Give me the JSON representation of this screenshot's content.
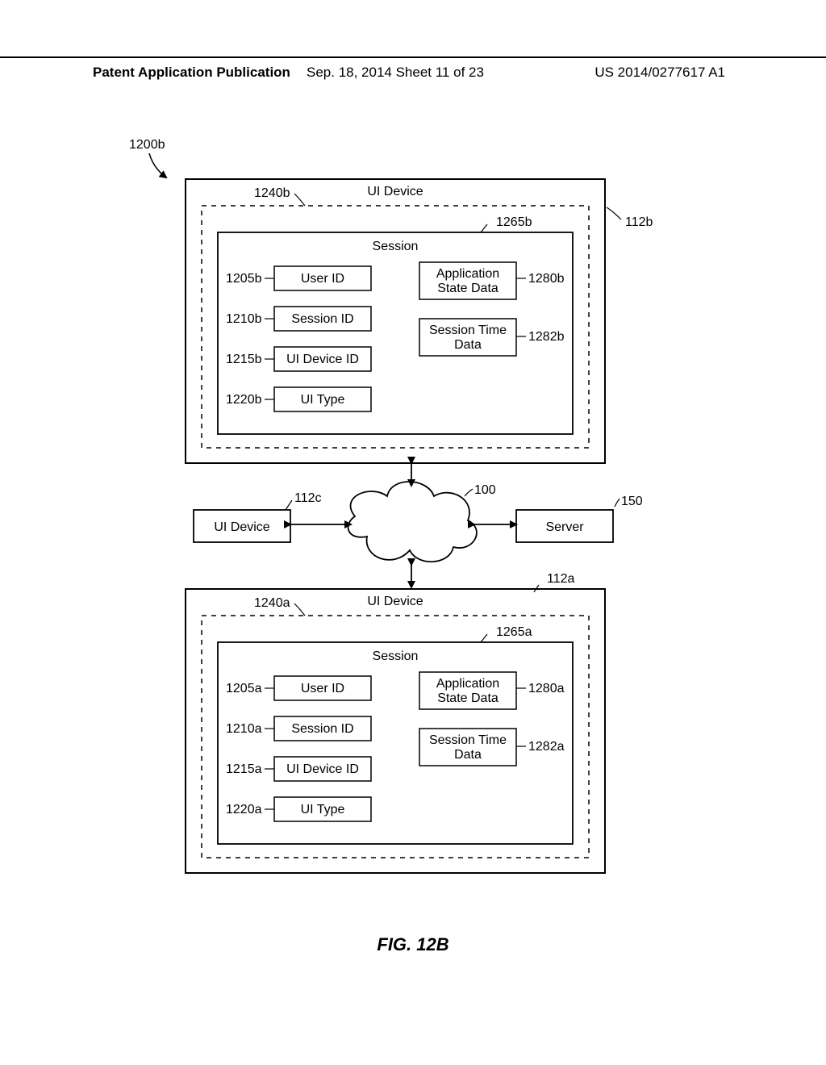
{
  "header": {
    "left": "Patent Application Publication",
    "mid": "Sep. 18, 2014  Sheet 11 of 23",
    "right": "US 2014/0277617 A1"
  },
  "figure_caption": "FIG. 12B",
  "ref_labels": {
    "overall": "1200b",
    "top_device": "112b",
    "top_session_frame": "1240b",
    "top_session": "1265b",
    "top_user_id": "1205b",
    "top_session_id": "1210b",
    "top_ui_device_id": "1215b",
    "top_ui_type": "1220b",
    "top_app_state": "1280b",
    "top_time_data": "1282b",
    "left_device": "112c",
    "cloud": "100",
    "server": "150",
    "bottom_device": "112a",
    "bottom_session_frame": "1240a",
    "bottom_session": "1265a",
    "bottom_user_id": "1205a",
    "bottom_session_id": "1210a",
    "bottom_ui_device_id": "1215a",
    "bottom_ui_type": "1220a",
    "bottom_app_state": "1280a",
    "bottom_time_data": "1282a"
  },
  "box_titles": {
    "ui_device": "UI Device",
    "session": "Session",
    "user_id": "User ID",
    "session_id": "Session ID",
    "ui_device_id": "UI Device ID",
    "ui_type": "UI Type",
    "app_state": "Application",
    "app_state2": "State Data",
    "time_data": "Session Time",
    "time_data2": "Data",
    "server": "Server"
  }
}
